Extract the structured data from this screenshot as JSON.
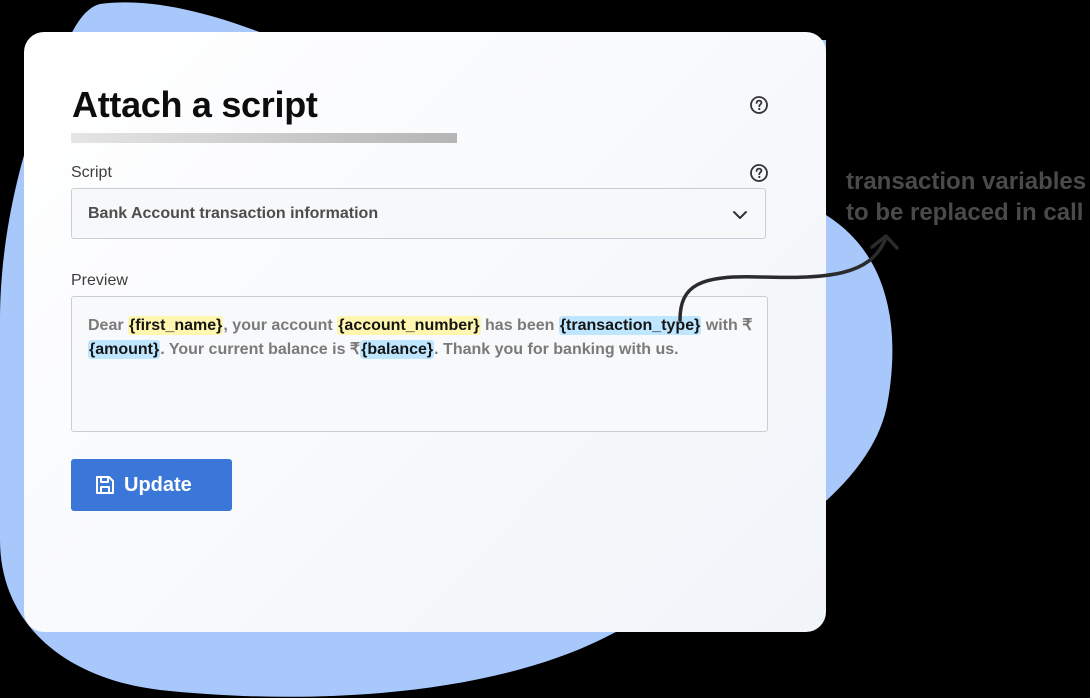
{
  "page": {
    "title": "Attach a script",
    "annotation_line1": "transaction variables",
    "annotation_line2": "to be replaced in call"
  },
  "script_field": {
    "label": "Script",
    "selected_value": "Bank Account transaction information"
  },
  "preview_field": {
    "label": "Preview",
    "parts": [
      "Dear ",
      "{first_name}",
      ", your account ",
      "{account_number}",
      " has been ",
      "{transaction_type}",
      " with ₹",
      "{amount}",
      ". Your current balance is ₹",
      "{balance}",
      ". Thank you for banking with us."
    ]
  },
  "update_button": {
    "label": "Update"
  },
  "icons": [
    "help-icon",
    "chevron-down-icon",
    "save-icon",
    "arrow-icon"
  ],
  "colors": {
    "background": "#000000",
    "blob": "#a8c8fb",
    "button": "#3b77d8",
    "highlight_yellow": "#fff6b0",
    "highlight_blue": "#bfe6ff"
  }
}
